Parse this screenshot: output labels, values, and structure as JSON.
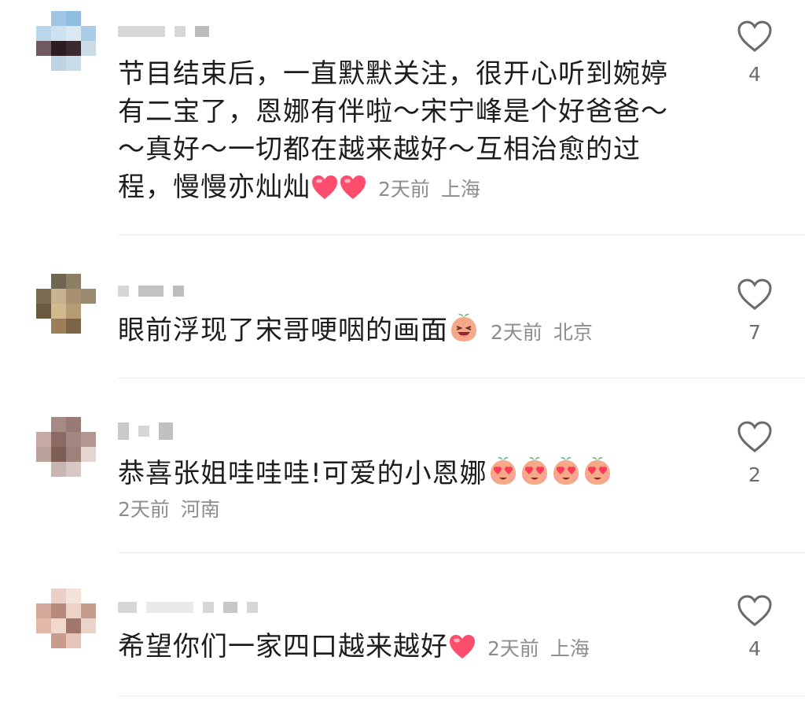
{
  "comments": [
    {
      "text": "节目结束后，一直默默关注，很开心听到婉婷有二宝了，恩娜有伴啦～宋宁峰是个好爸爸～～真好～一切都在越来越好～互相治愈的过程，慢慢亦灿灿",
      "emojis": [
        "red-heart-emoji",
        "red-heart-emoji"
      ],
      "time": "2天前",
      "location": "上海",
      "likes": "4"
    },
    {
      "text": "眼前浮现了宋哥哽咽的画面",
      "emojis": [
        "laughing-tears-emoji"
      ],
      "time": "2天前",
      "location": "北京",
      "likes": "7"
    },
    {
      "text": "恭喜张姐哇哇哇!可爱的小恩娜",
      "emojis": [
        "heart-eyes-emoji",
        "heart-eyes-emoji",
        "heart-eyes-emoji",
        "heart-eyes-emoji"
      ],
      "time": "2天前",
      "location": "河南",
      "likes": "2"
    },
    {
      "text": "希望你们一家四口越来越好",
      "emojis": [
        "red-heart-emoji"
      ],
      "time": "2天前",
      "location": "上海",
      "likes": "4"
    }
  ],
  "icons": {
    "like": "heart-outline-icon"
  },
  "colors": {
    "heart": "#ff4d6d",
    "meta": "#8d8d8d"
  }
}
